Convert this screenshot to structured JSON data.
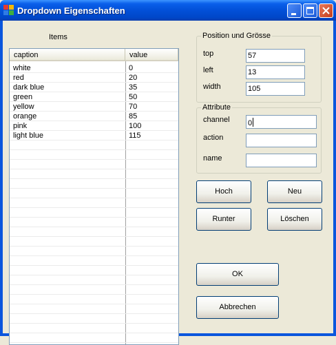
{
  "window": {
    "title": "Dropdown Eigenschaften",
    "icon": "app-window-icon",
    "controls": [
      "minimize-icon",
      "maximize-icon",
      "close-icon"
    ]
  },
  "items_label": "Items",
  "list": {
    "columns": [
      "caption",
      "value"
    ],
    "rows": [
      {
        "caption": "white",
        "value": "0"
      },
      {
        "caption": "red",
        "value": "20"
      },
      {
        "caption": "dark blue",
        "value": "35"
      },
      {
        "caption": "green",
        "value": "50"
      },
      {
        "caption": "yellow",
        "value": "70"
      },
      {
        "caption": "orange",
        "value": "85"
      },
      {
        "caption": "pink",
        "value": "100"
      },
      {
        "caption": "light blue",
        "value": "115"
      }
    ]
  },
  "position_group": {
    "title": "Position und Grösse",
    "top_label": "top",
    "top_value": "57",
    "left_label": "left",
    "left_value": "13",
    "width_label": "width",
    "width_value": "105"
  },
  "attribute_group": {
    "title": "Attribute",
    "channel_label": "channel",
    "channel_value": "0",
    "action_label": "action",
    "action_value": "",
    "name_label": "name",
    "name_value": ""
  },
  "buttons": {
    "hoch": "Hoch",
    "neu": "Neu",
    "runter": "Runter",
    "loeschen": "Löschen",
    "ok": "OK",
    "abbrechen": "Abbrechen"
  },
  "colors": {
    "titlebar": "#0250d8",
    "dialog_bg": "#ece9d8",
    "button_border": "#003c74",
    "textbox_border": "#7f9db9"
  }
}
